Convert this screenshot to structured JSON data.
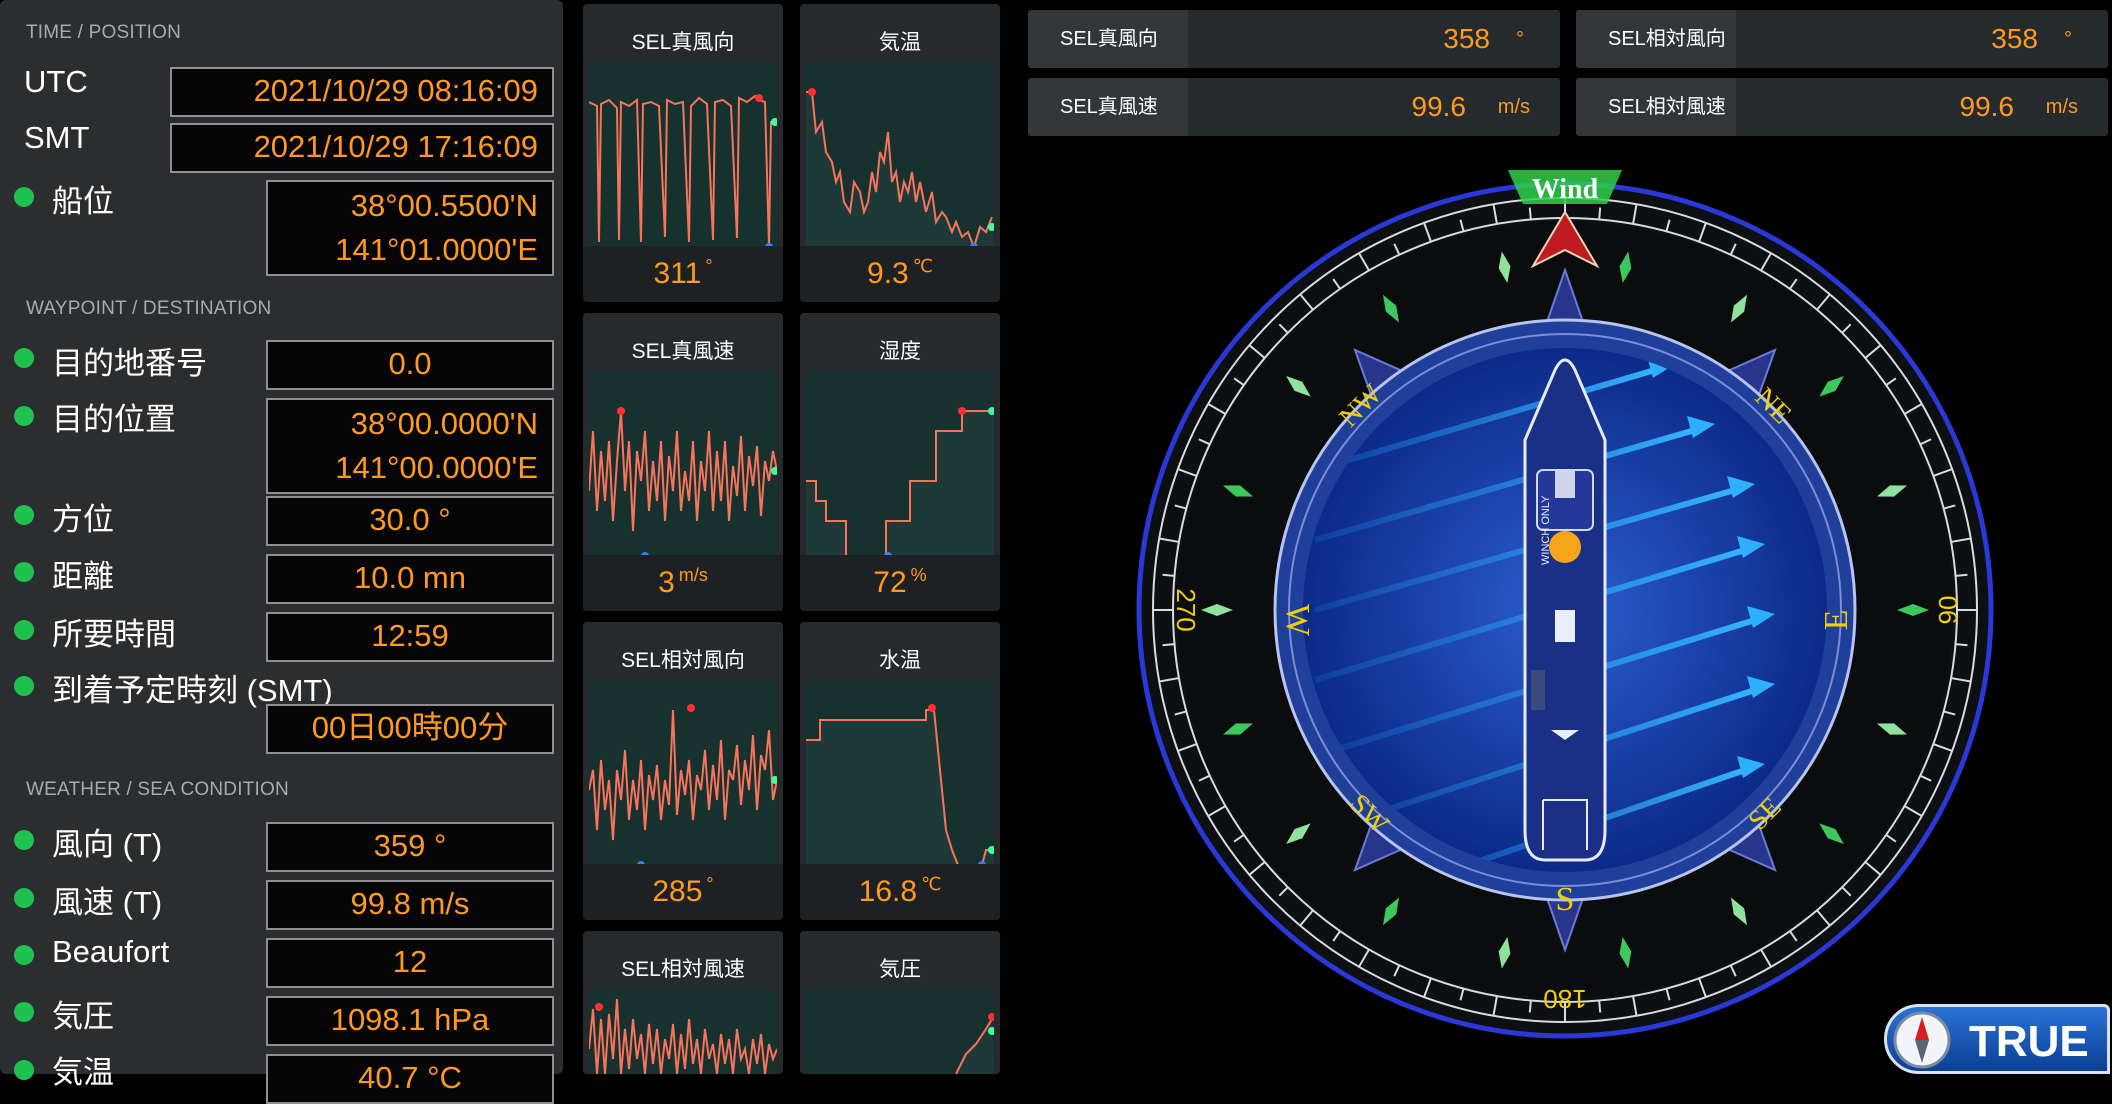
{
  "time_position": {
    "section": "TIME / POSITION",
    "utc_label": "UTC",
    "utc_value": "2021/10/29 08:16:09",
    "smt_label": "SMT",
    "smt_value": "2021/10/29 17:16:09",
    "pos_label": "船位",
    "lat": "38°00.5500'N",
    "lon": "141°01.0000'E"
  },
  "waypoint": {
    "section": "WAYPOINT / DESTINATION",
    "dest_no_label": "目的地番号",
    "dest_no_value": "0.0",
    "dest_pos_label": "目的位置",
    "dest_lat": "38°00.0000'N",
    "dest_lon": "141°00.0000'E",
    "bearing_label": "方位",
    "bearing_value": "30.0  °",
    "distance_label": "距離",
    "distance_value": "10.0  mn",
    "time_req_label": "所要時間",
    "time_req_value": "12:59",
    "eta_label": "到着予定時刻 (SMT)",
    "eta_value": "00日00時00分"
  },
  "weather": {
    "section": "WEATHER / SEA CONDITION",
    "wind_dir_label": "風向 (T)",
    "wind_dir_value": "359  °",
    "wind_speed_label": "風速 (T)",
    "wind_speed_value": "99.8  m/s",
    "beaufort_label": "Beaufort",
    "beaufort_value": "12",
    "pressure_label": "気圧",
    "pressure_value": "1098.1  hPa",
    "air_temp_label": "気温",
    "air_temp_value": "40.7  °C"
  },
  "mini_charts": [
    {
      "title": "SEL真風向",
      "value": "311",
      "unit": "°"
    },
    {
      "title": "気温",
      "value": "9.3",
      "unit": "℃"
    },
    {
      "title": "SEL真風速",
      "value": "3",
      "unit": "m/s"
    },
    {
      "title": "湿度",
      "value": "72",
      "unit": "%"
    },
    {
      "title": "SEL相対風向",
      "value": "285",
      "unit": "°"
    },
    {
      "title": "水温",
      "value": "16.8",
      "unit": "℃"
    },
    {
      "title": "SEL相対風速",
      "value": "",
      "unit": ""
    },
    {
      "title": "気圧",
      "value": "",
      "unit": ""
    }
  ],
  "readouts": {
    "true_dir_label": "SEL真風向",
    "true_dir_value": "358",
    "true_dir_unit": "°",
    "rel_dir_label": "SEL相対風向",
    "rel_dir_value": "358",
    "rel_dir_unit": "°",
    "true_speed_label": "SEL真風速",
    "true_speed_value": "99.6",
    "true_speed_unit": "m/s",
    "rel_speed_label": "SEL相対風速",
    "rel_speed_value": "99.6",
    "rel_speed_unit": "m/s"
  },
  "compass": {
    "wind_label": "Wind",
    "deg_0": "",
    "deg_90": "90",
    "deg_180": "180",
    "deg_270": "270",
    "N_label": "",
    "NE_label": "NE",
    "E_label": "E",
    "SE_label": "SE",
    "S_label": "S",
    "SW_label": "SW",
    "W_label": "W",
    "NW_label": "NW",
    "ship_text": "WINCH ONLY",
    "mode_badge": "TRUE"
  },
  "colors": {
    "value_orange": "#ff9a1f",
    "status_green": "#1fc24e",
    "line_coral": "#f7735c",
    "compass_blue": "#1f3f9a",
    "wind_green": "#2fd04a"
  }
}
